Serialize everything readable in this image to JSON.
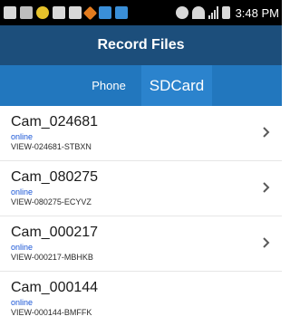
{
  "statusbar": {
    "time": "3:48 PM",
    "icons": [
      "back-icon",
      "usb-icon",
      "app-icon",
      "picture-icon",
      "gallery-icon",
      "diamond-app-icon",
      "blue-app-icon",
      "blue-app-icon-2",
      "alarm-icon",
      "wifi-icon",
      "signal-icon",
      "battery-icon"
    ]
  },
  "header": {
    "title": "Record Files",
    "bar_color": "#1c4e7b"
  },
  "tabs": {
    "phone_label": "Phone",
    "sdcard_label": "SDCard",
    "selected": "SDCard",
    "bar_color": "#2277be"
  },
  "cameras": [
    {
      "name": "Cam_024681",
      "status": "online",
      "view_id": "VIEW-024681-STBXN",
      "chevron": true
    },
    {
      "name": "Cam_080275",
      "status": "online",
      "view_id": "VIEW-080275-ECYVZ",
      "chevron": true
    },
    {
      "name": "Cam_000217",
      "status": "online",
      "view_id": "VIEW-000217-MBHKB",
      "chevron": true
    },
    {
      "name": "Cam_000144",
      "status": "online",
      "view_id": "VIEW-000144-BMFFK",
      "chevron": false
    }
  ]
}
